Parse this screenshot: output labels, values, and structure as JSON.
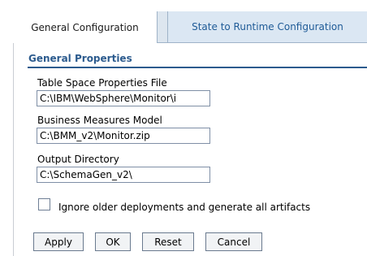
{
  "tabs": [
    {
      "label": "General Configuration",
      "active": true
    },
    {
      "label": "State to Runtime Configuration",
      "active": false
    }
  ],
  "section": {
    "title": "General Properties"
  },
  "fields": [
    {
      "label": "Table Space Properties File",
      "value": "C:\\IBM\\WebSphere\\Monitor\\i"
    },
    {
      "label": "Business Measures Model",
      "value": "C:\\BMM_v2\\Monitor.zip"
    },
    {
      "label": "Output Directory",
      "value": "C:\\SchemaGen_v2\\"
    }
  ],
  "checkbox": {
    "label": "Ignore older deployments and generate all artifacts",
    "checked": false
  },
  "buttons": {
    "apply": "Apply",
    "ok": "OK",
    "reset": "Reset",
    "cancel": "Cancel"
  },
  "colors": {
    "tab_bar": "#dde6ef",
    "inactive_tab_text": "#1f5b97",
    "section_title": "#2c5b8e"
  }
}
